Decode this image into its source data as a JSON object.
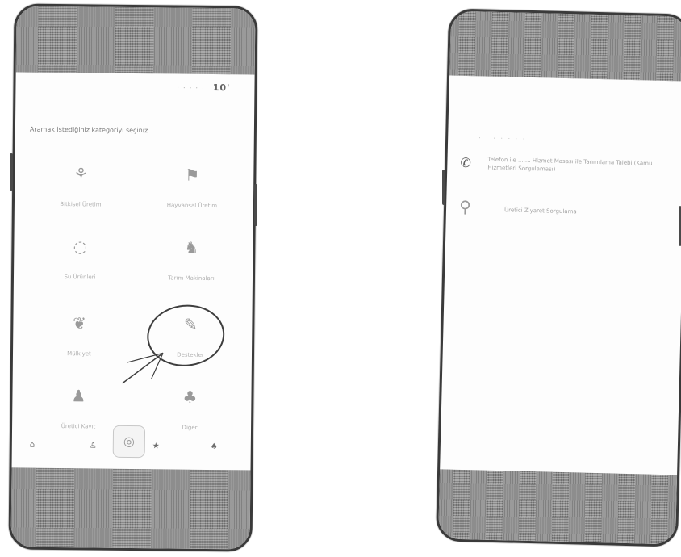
{
  "left_screen": {
    "status": {
      "time": "·  ·  ·  ·  ·",
      "signal": "10'"
    },
    "prompt": "Aramak istediğiniz kategoriyi seçiniz",
    "categories": [
      {
        "icon": "wheat-icon",
        "glyph": "⚘",
        "label": "Bitkisel Üretim"
      },
      {
        "icon": "flag-icon",
        "glyph": "⚑",
        "label": "Hayvansal Üretim"
      },
      {
        "icon": "fish-icon",
        "glyph": "◌",
        "label": "Su Ürünleri"
      },
      {
        "icon": "tractor-icon",
        "glyph": "♞",
        "label": "Tarım Makinaları"
      },
      {
        "icon": "leaf-icon",
        "glyph": "❦",
        "label": "Mülkiyet"
      },
      {
        "icon": "tools-icon",
        "glyph": "✎",
        "label": "Destekler"
      },
      {
        "icon": "people-icon",
        "glyph": "♟",
        "label": "Üretici Kayıt"
      },
      {
        "icon": "plant-icon",
        "glyph": "♣",
        "label": "Diğer"
      }
    ],
    "nav": {
      "home": "⌂",
      "user": "♙",
      "center": "◎",
      "star": "★",
      "tree": "♠"
    }
  },
  "right_screen": {
    "title": "·  ·  ·  ·  ·  ·  ·",
    "rows": [
      {
        "icon": "phone-off-icon",
        "glyph": "✆",
        "text": "Telefon ile ....... Hizmet Masası ile Tanımlama Talebi (Kamu Hizmetleri Sorgulaması)"
      },
      {
        "icon": "location-person-icon",
        "glyph": "⚲",
        "text": "Üretici Ziyaret Sorgulama"
      }
    ]
  },
  "colors": {
    "frame": "#3a3a3a",
    "bar": "#8c8c8c",
    "annotation": "#3e3e3e"
  }
}
